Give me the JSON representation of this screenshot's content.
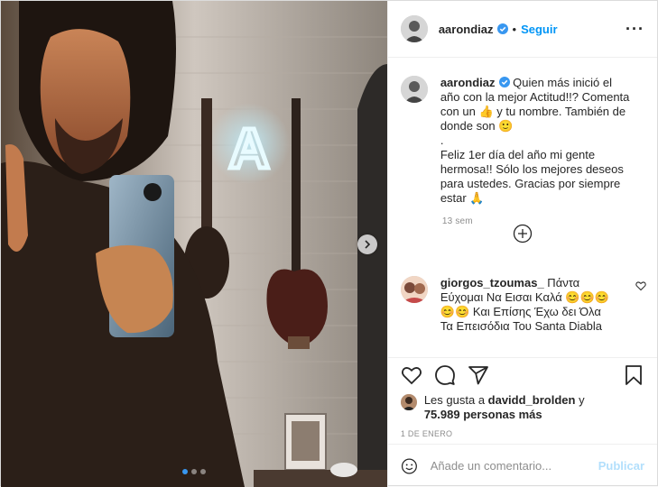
{
  "colors": {
    "accent": "#0095f6",
    "verified": "#3897f0",
    "publish_disabled": "#b2dffc",
    "neon": "#a8e9ff"
  },
  "media": {
    "sign_letter": "A",
    "carousel_next_icon": "chevron-right-icon",
    "slides": 3,
    "active_slide": 1
  },
  "header": {
    "username": "aarondiaz",
    "separator": "•",
    "follow_label": "Seguir",
    "more_label": "···"
  },
  "caption": {
    "username": "aarondiaz",
    "text": " Quien más inició el año con la mejor Actitud!!? Comenta con un 👍 y tu nombre. También de donde son 🙂\n.\nFeliz 1er día del año mi gente hermosa!! Sólo los mejores deseos para ustedes. Gracias por siempre estar 🙏",
    "time": "13 sem"
  },
  "comment": {
    "username": "giorgos_tzoumas_",
    "text": " Πάντα Εύχομαι Να Εισαι Καλά 😊😊😊😊😊 Και Επίσης Έχω δει Όλα Τα Επεισόδια Του Santa Diabla"
  },
  "likes": {
    "prefix": "Les gusta a ",
    "first_user": "davidd_brolden",
    "connector": " y",
    "count": "75.989 personas más"
  },
  "date": "1 DE ENERO",
  "add_comment": {
    "placeholder": "Añade un comentario...",
    "publish_label": "Publicar"
  }
}
